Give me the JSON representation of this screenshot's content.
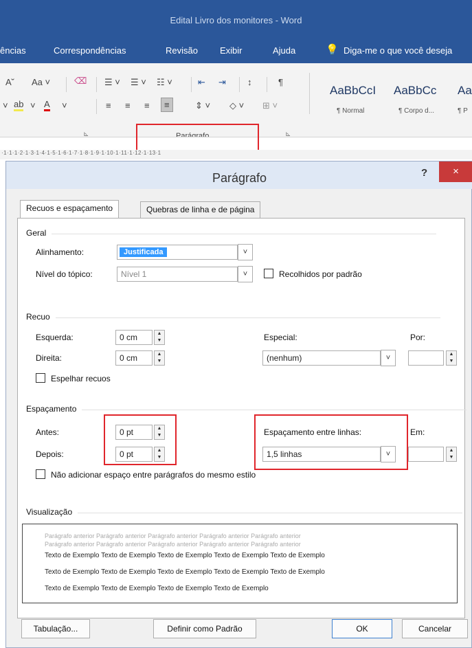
{
  "window": {
    "title": "Edital Livro dos monitores  -  Word"
  },
  "menu": [
    "ências",
    "Correspondências",
    "Revisão",
    "Exibir",
    "Ajuda"
  ],
  "tellme": "Diga-me o que você deseja",
  "ribbon": {
    "group_label": "Parágrafo",
    "styles": [
      {
        "sample": "AaBbCcI",
        "name": "¶ Normal"
      },
      {
        "sample": "AaBbCc",
        "name": "¶ Corpo d..."
      },
      {
        "sample": "Aa",
        "name": "¶ P"
      }
    ],
    "font_size_btn": "Aa",
    "pilcrow": "¶"
  },
  "ruler": "·1·1·1·2·1·3·1·4·1·5·1·6·1·7·1·8·1·9·1·10·1·11·1·12·1·13·1",
  "dialog": {
    "title": "Parágrafo",
    "help": "?",
    "close": "×",
    "tabs": [
      "Recuos e espaçamento",
      "Quebras de linha e de página"
    ],
    "sections": {
      "geral": "Geral",
      "recuo": "Recuo",
      "espacamento": "Espaçamento",
      "visualizacao": "Visualização"
    },
    "alinhamento": {
      "label": "Alinhamento:",
      "value": "Justificada"
    },
    "nivel": {
      "label": "Nível do tópico:",
      "value": "Nível 1"
    },
    "recolhidos": "Recolhidos por padrão",
    "esquerda": {
      "label": "Esquerda:",
      "value": "0 cm"
    },
    "direita": {
      "label": "Direita:",
      "value": "0 cm"
    },
    "especial": {
      "label": "Especial:",
      "value": "(nenhum)"
    },
    "por": "Por:",
    "espelhar": "Espelhar recuos",
    "antes": {
      "label": "Antes:",
      "value": "0 pt"
    },
    "depois": {
      "label": "Depois:",
      "value": "0 pt"
    },
    "entre_linhas": {
      "label": "Espaçamento entre linhas:",
      "value": "1,5 linhas"
    },
    "em": "Em:",
    "nao_adicionar": "Não adicionar espaço entre parágrafos do mesmo estilo",
    "preview": {
      "prev1": "Parágrafo anterior Parágrafo anterior Parágrafo anterior Parágrafo anterior Parágrafo anterior",
      "prev2": "Parágrafo anterior Parágrafo anterior Parágrafo anterior Parágrafo anterior Parágrafo anterior",
      "line1": "Texto de Exemplo Texto de Exemplo Texto de Exemplo Texto de Exemplo Texto de Exemplo",
      "line2": "Texto de Exemplo Texto de Exemplo Texto de Exemplo Texto de Exemplo Texto de Exemplo",
      "line3": "Texto de Exemplo Texto de Exemplo Texto de Exemplo Texto de Exemplo"
    },
    "buttons": {
      "tabulacao": "Tabulação...",
      "padrao": "Definir como Padrão",
      "ok": "OK",
      "cancelar": "Cancelar"
    }
  },
  "colors": {
    "word_blue": "#2b579a",
    "highlight_red": "#e0252b",
    "selection": "#3399ff"
  }
}
